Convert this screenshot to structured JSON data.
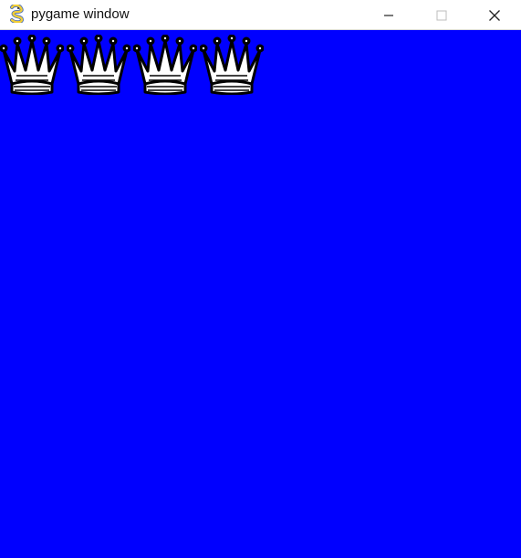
{
  "window": {
    "title": "pygame window",
    "app_icon": "pygame-snake-icon",
    "controls": [
      {
        "name": "minimize-icon"
      },
      {
        "name": "maximize-icon",
        "disabled": true
      },
      {
        "name": "close-icon"
      }
    ]
  },
  "game": {
    "background_color": "#0000ff",
    "pieces": [
      {
        "type": "white-queen-icon"
      },
      {
        "type": "white-queen-icon"
      },
      {
        "type": "white-queen-icon"
      },
      {
        "type": "white-queen-icon"
      }
    ]
  }
}
